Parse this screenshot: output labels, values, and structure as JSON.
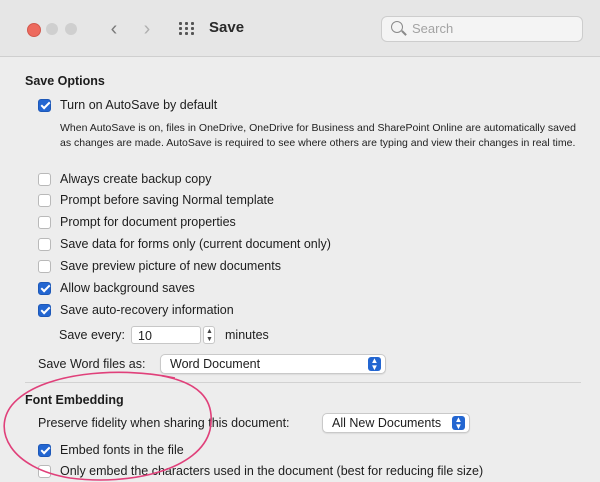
{
  "window": {
    "title": "Save",
    "search_placeholder": "Search"
  },
  "save_options": {
    "heading": "Save Options",
    "autosave": {
      "label": "Turn on AutoSave by default",
      "checked": true,
      "description": "When AutoSave is on, files in OneDrive, OneDrive for Business and SharePoint Online are automatically saved as changes are made. AutoSave is required to see where others are typing and view their changes in real time."
    },
    "options": [
      {
        "label": "Always create backup copy",
        "checked": false
      },
      {
        "label": "Prompt before saving Normal template",
        "checked": false
      },
      {
        "label": "Prompt for document properties",
        "checked": false
      },
      {
        "label": "Save data for forms only (current document only)",
        "checked": false
      },
      {
        "label": "Save preview picture of new documents",
        "checked": false
      },
      {
        "label": "Allow background saves",
        "checked": true
      },
      {
        "label": "Save auto-recovery information",
        "checked": true
      }
    ],
    "save_every_label": "Save every:",
    "save_every_value": "10",
    "minutes_label": "minutes",
    "save_format_label": "Save Word files as:",
    "save_format_value": "Word Document"
  },
  "font_embedding": {
    "heading": "Font Embedding",
    "preserve_label": "Preserve fidelity when sharing this document:",
    "preserve_value": "All New Documents",
    "options": [
      {
        "label": "Embed fonts in the file",
        "checked": true
      },
      {
        "label": "Only embed the characters used in the document (best for reducing file size)",
        "checked": false
      }
    ]
  },
  "colors": {
    "accent": "#2366d1",
    "close_light": "#ed6a5e",
    "annotation": "#e0407a"
  }
}
